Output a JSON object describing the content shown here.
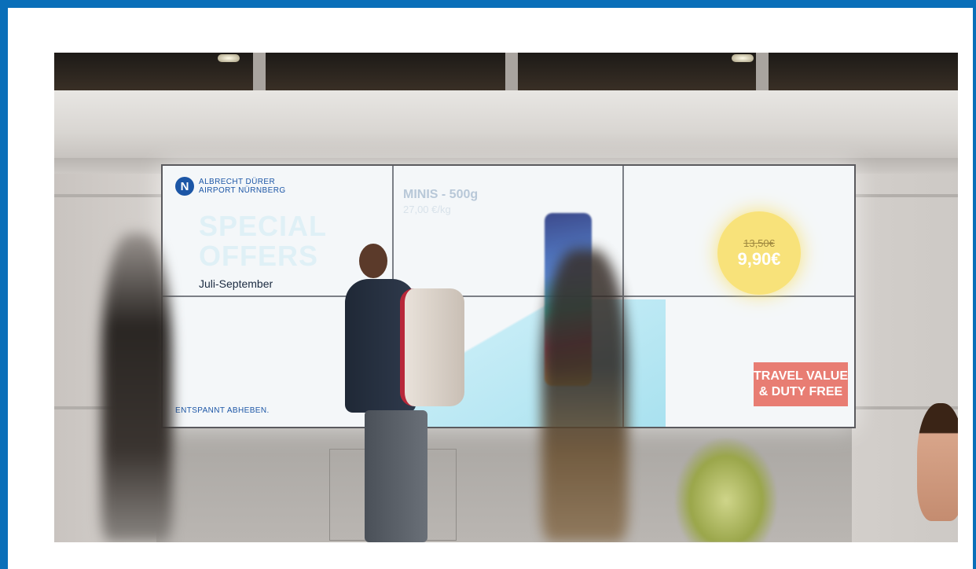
{
  "screen": {
    "logo_line1": "ALBRECHT DÜRER",
    "logo_line2": "AIRPORT NÜRNBERG",
    "logo_mark": "N",
    "offer_line1": "SPECIAL",
    "offer_line2": "OFFERS",
    "period": "Juli-September",
    "product_name": "MINIS - 500g",
    "product_unit_price": "27,00 €/kg",
    "old_price": "13,50€",
    "new_price": "9,90€",
    "badge_line1": "TRAVEL VALUE",
    "badge_line2": "& DUTY FREE",
    "tagline": "ENTSPANNT ABHEBEN."
  },
  "colors": {
    "frame_border": "#0a6fb9",
    "brand_blue": "#1c56a6",
    "price_circle": "#f8e27a",
    "badge": "#e87d73"
  }
}
